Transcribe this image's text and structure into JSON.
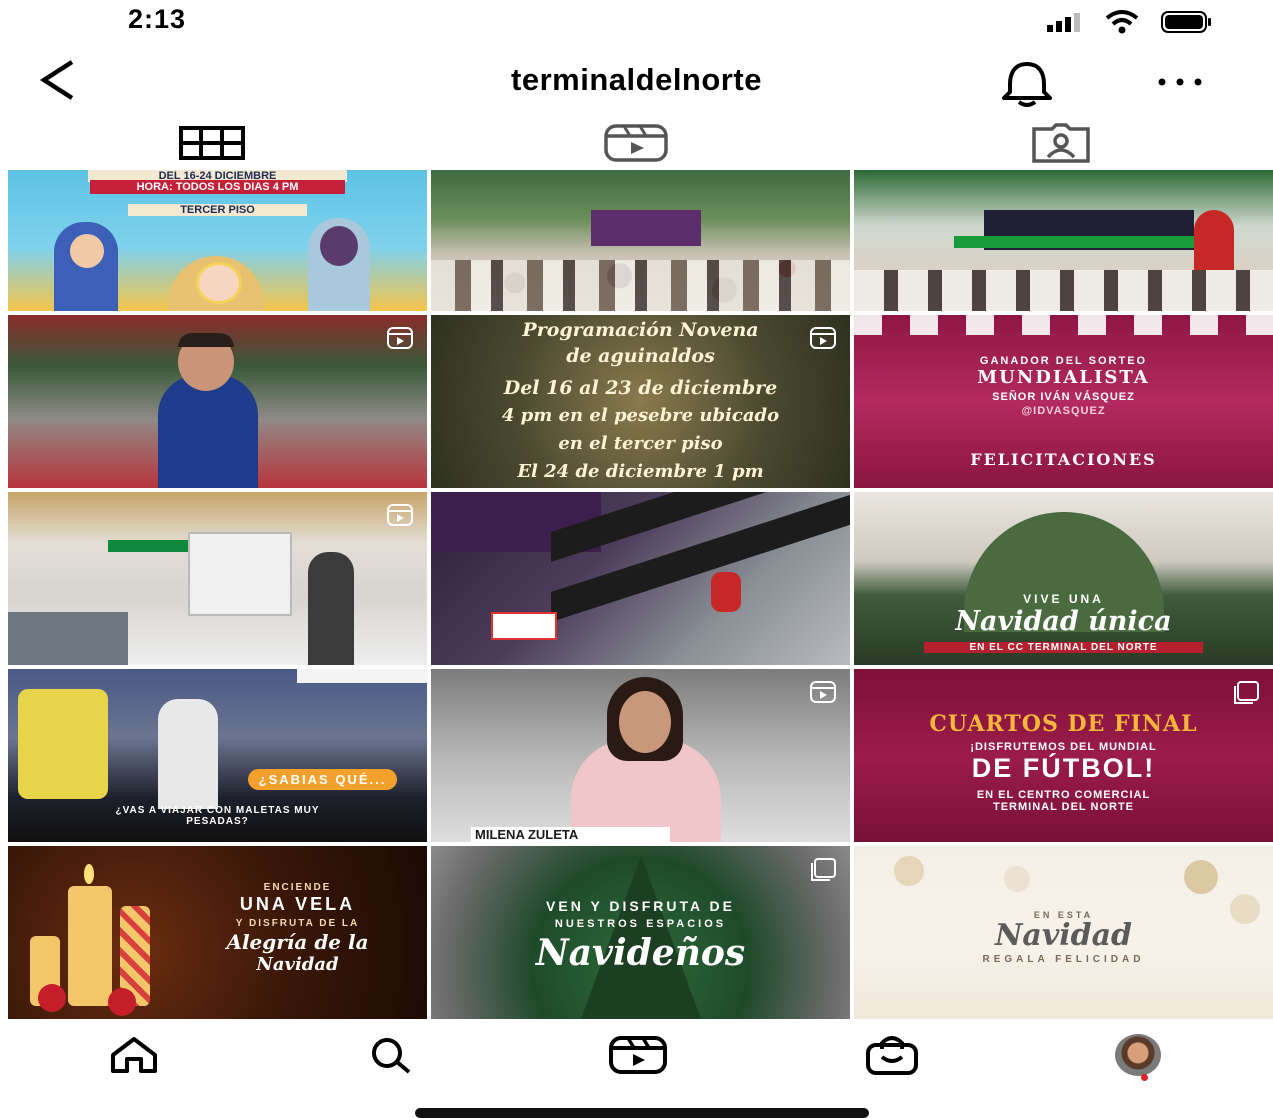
{
  "status_bar": {
    "time": "2:13"
  },
  "header": {
    "username": "terminaldelnorte"
  },
  "icons": {
    "back": "chevron-left-icon",
    "bell": "bell-icon",
    "more": "more-icon",
    "grid": "grid-icon",
    "reels": "reels-icon",
    "tagged": "tagged-icon",
    "home": "home-icon",
    "search": "search-icon",
    "shop": "shop-icon"
  },
  "colors": {
    "accent_red": "#e0242b",
    "maroon": "#7b1238",
    "brand_orange": "#f4a02d"
  },
  "posts": [
    {
      "type": "image",
      "lines": [
        "DEL 16-24 DICIEMBRE",
        "HORA: TODOS LOS DIAS 4 PM",
        "TERCER PISO"
      ]
    },
    {
      "type": "image"
    },
    {
      "type": "image"
    },
    {
      "type": "reel"
    },
    {
      "type": "reel",
      "lines": [
        "Programación Novena",
        "de aguinaldos",
        "Del 16 al 23 de diciembre",
        "4 pm en el pesebre ubicado",
        "en el tercer piso",
        "El 24 de diciembre 1 pm"
      ]
    },
    {
      "type": "image",
      "lines": [
        "GANADOR DEL SORTEO",
        "MUNDIALISTA",
        "SEÑOR IVÁN VÁSQUEZ",
        "@IDVASQUEZ",
        "FELICITACIONES"
      ]
    },
    {
      "type": "reel"
    },
    {
      "type": "image"
    },
    {
      "type": "image",
      "lines": [
        "VIVE UNA",
        "Navidad única",
        "EN EL CC TERMINAL DEL NORTE"
      ]
    },
    {
      "type": "image",
      "lines": [
        "¿SABIAS QUÉ...",
        "¿VAS A VIAJAR CON MALETAS MUY PESADAS?"
      ]
    },
    {
      "type": "reel",
      "lines": [
        "MILENA ZULETA"
      ]
    },
    {
      "type": "multi",
      "lines": [
        "CUARTOS DE FINAL",
        "¡DISFRUTEMOS DEL MUNDIAL",
        "DE FÚTBOL!",
        "EN EL CENTRO COMERCIAL",
        "TERMINAL DEL NORTE"
      ]
    },
    {
      "type": "image",
      "lines": [
        "ENCIENDE",
        "UNA VELA",
        "Y DISFRUTA DE LA",
        "Alegría de la",
        "Navidad"
      ]
    },
    {
      "type": "multi",
      "lines": [
        "VEN Y DISFRUTA DE",
        "NUESTROS ESPACIOS",
        "Navideños"
      ]
    },
    {
      "type": "image",
      "lines": [
        "EN ESTA",
        "Navidad",
        "REGALA FELICIDAD"
      ]
    }
  ]
}
